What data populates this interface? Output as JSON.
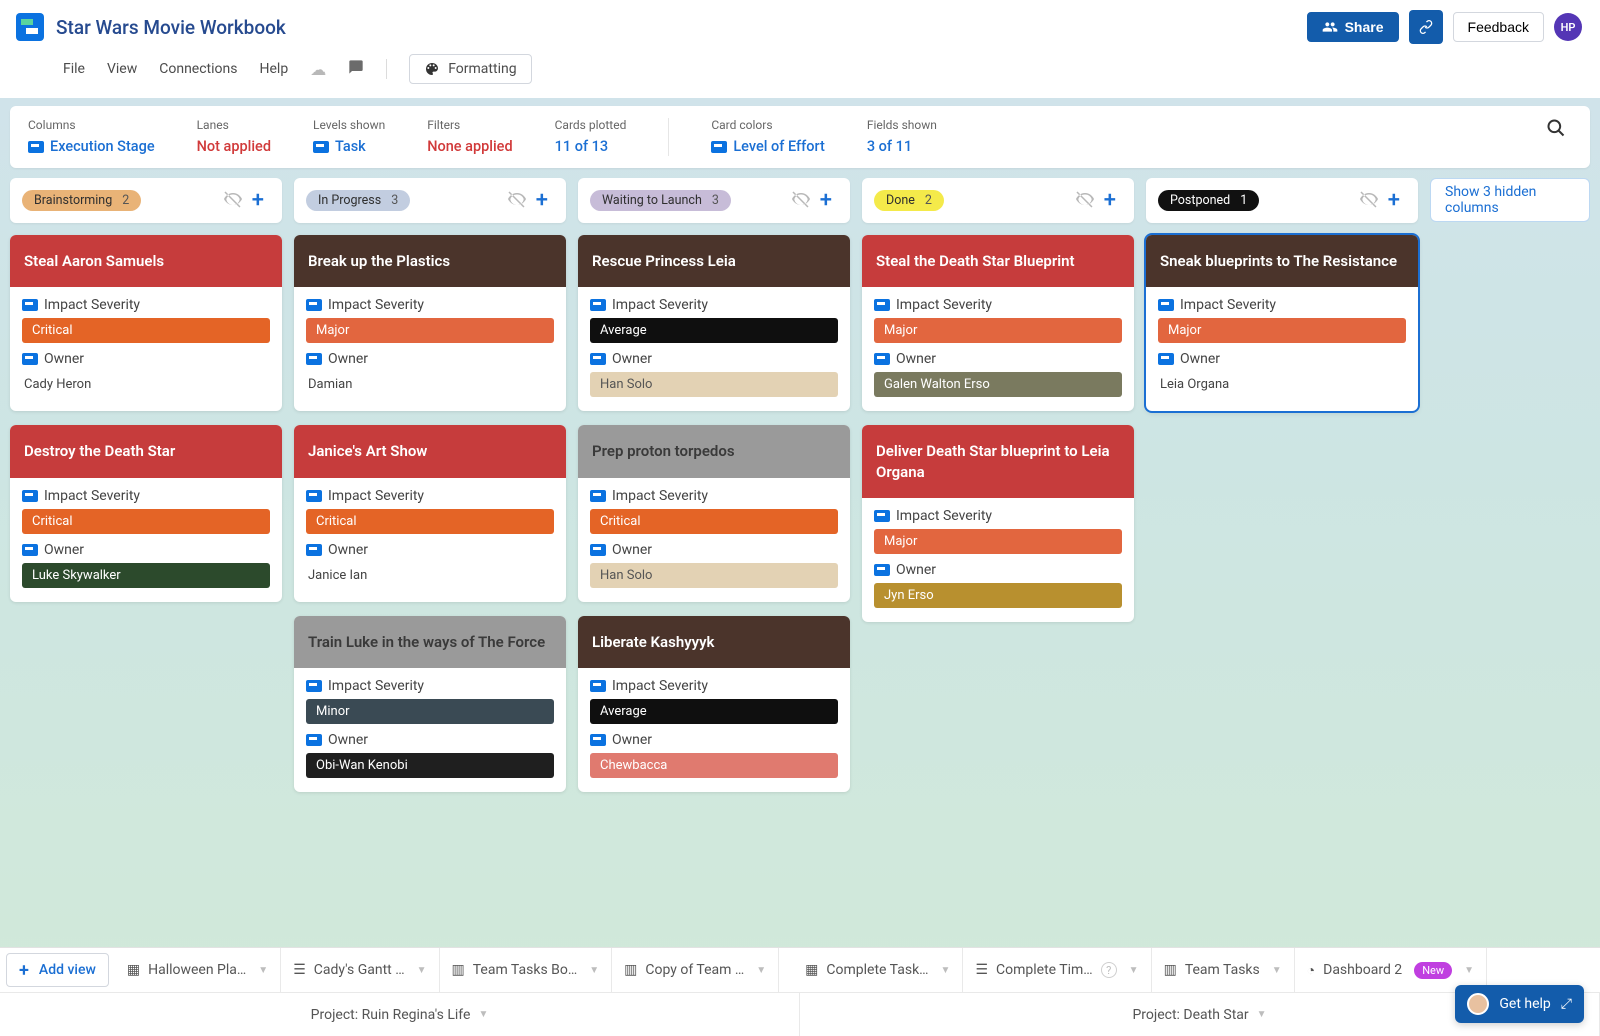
{
  "header": {
    "title": "Star Wars Movie Workbook",
    "share": "Share",
    "feedback": "Feedback",
    "avatar": "HP"
  },
  "menu": {
    "file": "File",
    "view": "View",
    "connections": "Connections",
    "help": "Help",
    "formatting": "Formatting"
  },
  "filters": {
    "columns_label": "Columns",
    "columns_value": "Execution Stage",
    "lanes_label": "Lanes",
    "lanes_value": "Not applied",
    "levels_label": "Levels shown",
    "levels_value": "Task",
    "filters_label": "Filters",
    "filters_value": "None applied",
    "cards_label": "Cards plotted",
    "cards_value": "11 of 13",
    "colors_label": "Card colors",
    "colors_value": "Level of Effort",
    "fields_label": "Fields shown",
    "fields_value": "3 of 11"
  },
  "board": {
    "show_hidden": "Show 3 hidden columns",
    "columns": [
      {
        "name": "Brainstorming",
        "count": "2",
        "pill": "#e9b377"
      },
      {
        "name": "In Progress",
        "count": "3",
        "pill": "#c2cde0"
      },
      {
        "name": "Waiting to Launch",
        "count": "3",
        "pill": "#c7bcd8"
      },
      {
        "name": "Done",
        "count": "2",
        "pill": "#f4ea4a"
      },
      {
        "name": "Postponed",
        "count": "1",
        "pill": "#111111",
        "pill_text": "#ffffff"
      }
    ],
    "labels": {
      "impact": "Impact Severity",
      "owner": "Owner"
    },
    "cards": {
      "c0": [
        {
          "title": "Steal Aaron Samuels",
          "hd": "#c63c3c",
          "impact": "Critical",
          "impact_bg": "#e46426",
          "owner": "Cady Heron",
          "owner_bg": ""
        },
        {
          "title": "Destroy the Death Star",
          "hd": "#c63c3c",
          "impact": "Critical",
          "impact_bg": "#e46426",
          "owner": "Luke Skywalker",
          "owner_bg": "#2c4a2c"
        }
      ],
      "c1": [
        {
          "title": "Break up the Plastics",
          "hd": "#4b342b",
          "impact": "Major",
          "impact_bg": "#e2663f",
          "owner": "Damian",
          "owner_bg": ""
        },
        {
          "title": "Janice's Art Show",
          "hd": "#c63c3c",
          "impact": "Critical",
          "impact_bg": "#e46426",
          "owner": "Janice Ian",
          "owner_bg": ""
        },
        {
          "title": "Train Luke in the ways of The Force",
          "hd": "#9a9a9a",
          "hd_text": "#3a3a3a",
          "impact": "Minor",
          "impact_bg": "#3a4a54",
          "owner": "Obi-Wan Kenobi",
          "owner_bg": "#1f1f1f"
        }
      ],
      "c2": [
        {
          "title": "Rescue Princess Leia",
          "hd": "#4b342b",
          "impact": "Average",
          "impact_bg": "#0f0f0f",
          "owner": "Han Solo",
          "owner_bg": "#e3d2b4",
          "owner_text": "#555"
        },
        {
          "title": "Prep proton torpedos",
          "hd": "#9a9a9a",
          "hd_text": "#3a3a3a",
          "impact": "Critical",
          "impact_bg": "#e46426",
          "owner": "Han Solo",
          "owner_bg": "#e3d2b4",
          "owner_text": "#555"
        },
        {
          "title": "Liberate Kashyyyk",
          "hd": "#4b342b",
          "impact": "Average",
          "impact_bg": "#0f0f0f",
          "owner": "Chewbacca",
          "owner_bg": "#e07a6f"
        }
      ],
      "c3": [
        {
          "title": "Steal the Death Star Blueprint",
          "hd": "#c63c3c",
          "impact": "Major",
          "impact_bg": "#e2663f",
          "owner": "Galen Walton Erso",
          "owner_bg": "#7a7a5f"
        },
        {
          "title": "Deliver Death Star blueprint to Leia Organa",
          "hd": "#c63c3c",
          "impact": "Major",
          "impact_bg": "#e2663f",
          "owner": "Jyn Erso",
          "owner_bg": "#b8902f"
        }
      ],
      "c4": [
        {
          "title": "Sneak blueprints to The Resistance",
          "hd": "#4b342b",
          "impact": "Major",
          "impact_bg": "#e2663f",
          "owner": "Leia Organa",
          "owner_bg": "",
          "selected": true
        }
      ]
    }
  },
  "tabs": {
    "addview": "Add view",
    "t0": "Halloween Pla…",
    "t1": "Cady's Gantt …",
    "t2": "Team Tasks Bo…",
    "t3": "Copy of Team …",
    "t4": "Complete Task…",
    "t5": "Complete Tim…",
    "t6": "Team Tasks",
    "t7": "Dashboard 2",
    "new": "New",
    "proj0": "Project: Ruin Regina's Life",
    "proj1": "Project: Death Star"
  },
  "help": {
    "label": "Get help"
  }
}
